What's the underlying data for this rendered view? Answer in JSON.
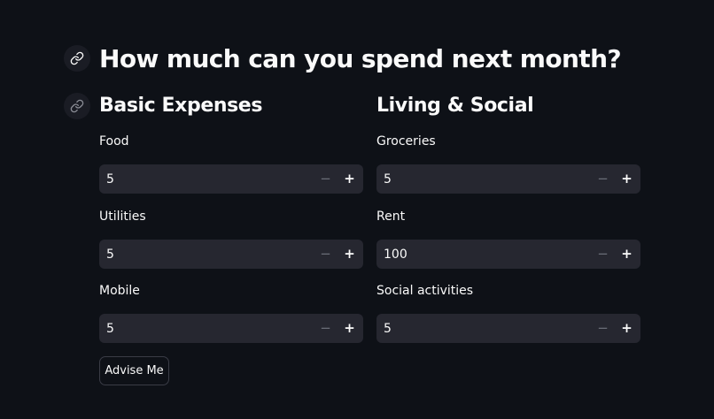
{
  "header": {
    "title": "How much can you spend next month?"
  },
  "icons": {
    "title_anchor": "link-icon",
    "section_anchor": "link-icon"
  },
  "columns": {
    "left": {
      "heading": "Basic Expenses",
      "fields": [
        {
          "label": "Food",
          "value": "5"
        },
        {
          "label": "Utilities",
          "value": "5"
        },
        {
          "label": "Mobile",
          "value": "5"
        }
      ]
    },
    "right": {
      "heading": "Living & Social",
      "fields": [
        {
          "label": "Groceries",
          "value": "5"
        },
        {
          "label": "Rent",
          "value": "100"
        },
        {
          "label": "Social activities",
          "value": "5"
        }
      ]
    }
  },
  "stepper": {
    "decrement_symbol": "−",
    "increment_symbol": "+"
  },
  "actions": {
    "advise_label": "Advise Me"
  },
  "colors": {
    "background": "#0e1117",
    "input_background": "#262730",
    "text": "#fafafa"
  }
}
